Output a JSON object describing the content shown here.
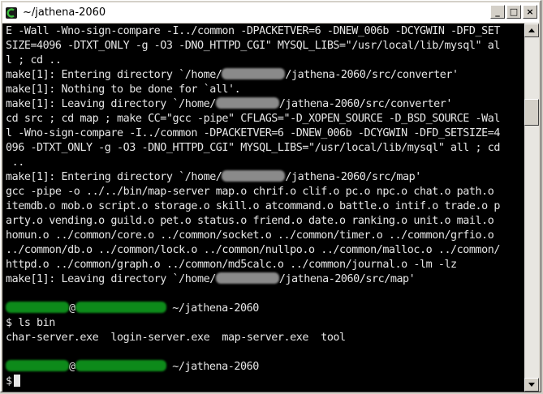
{
  "window": {
    "title": "~/jathena-2060",
    "icon": "cygwin-terminal-icon",
    "controls": {
      "minimize": "_",
      "maximize": "□",
      "close": "×"
    }
  },
  "terminal": {
    "lines": [
      {
        "parts": [
          {
            "t": "E -Wall -Wno-sign-compare -I../common -DPACKETVER=6 -DNEW_006b -DCYGWIN -DFD_SET"
          }
        ]
      },
      {
        "parts": [
          {
            "t": "SIZE=4096 -DTXT_ONLY -g -O3 -DNO_HTTPD_CGI\" MYSQL_LIBS=\"/usr/local/lib/mysql\" al"
          }
        ]
      },
      {
        "parts": [
          {
            "t": "l ; cd .."
          }
        ]
      },
      {
        "parts": [
          {
            "t": "make[1]: Entering directory `/home/"
          },
          {
            "blur": "gray",
            "w": 78
          },
          {
            "t": "/jathena-2060/src/converter'"
          }
        ]
      },
      {
        "parts": [
          {
            "t": "make[1]: Nothing to be done for `all'."
          }
        ]
      },
      {
        "parts": [
          {
            "t": "make[1]: Leaving directory `/home/"
          },
          {
            "blur": "gray",
            "w": 78
          },
          {
            "t": "/jathena-2060/src/converter'"
          }
        ]
      },
      {
        "parts": [
          {
            "t": "cd src ; cd map ; make CC=\"gcc -pipe\" CFLAGS=\"-D_XOPEN_SOURCE -D_BSD_SOURCE -Wal"
          }
        ]
      },
      {
        "parts": [
          {
            "t": "l -Wno-sign-compare -I../common -DPACKETVER=6 -DNEW_006b -DCYGWIN -DFD_SETSIZE=4"
          }
        ]
      },
      {
        "parts": [
          {
            "t": "096 -DTXT_ONLY -g -O3 -DNO_HTTPD_CGI\" MYSQL_LIBS=\"/usr/local/lib/mysql\" all ; cd"
          }
        ]
      },
      {
        "parts": [
          {
            "t": " .."
          }
        ]
      },
      {
        "parts": [
          {
            "t": "make[1]: Entering directory `/home/"
          },
          {
            "blur": "gray",
            "w": 78
          },
          {
            "t": "/jathena-2060/src/map'"
          }
        ]
      },
      {
        "parts": [
          {
            "t": "gcc -pipe -o ../../bin/map-server map.o chrif.o clif.o pc.o npc.o chat.o path.o"
          }
        ]
      },
      {
        "parts": [
          {
            "t": "itemdb.o mob.o script.o storage.o skill.o atcommand.o battle.o intif.o trade.o p"
          }
        ]
      },
      {
        "parts": [
          {
            "t": "arty.o vending.o guild.o pet.o status.o friend.o date.o ranking.o unit.o mail.o"
          }
        ]
      },
      {
        "parts": [
          {
            "t": "homun.o ../common/core.o ../common/socket.o ../common/timer.o ../common/grfio.o"
          }
        ]
      },
      {
        "parts": [
          {
            "t": "../common/db.o ../common/lock.o ../common/nullpo.o ../common/malloc.o ../common/"
          }
        ]
      },
      {
        "parts": [
          {
            "t": "httpd.o ../common/graph.o ../common/md5calc.o ../common/journal.o -lm -lz"
          }
        ]
      },
      {
        "parts": [
          {
            "t": "make[1]: Leaving directory `/home/"
          },
          {
            "blur": "gray",
            "w": 78
          },
          {
            "t": "/jathena-2060/src/map'"
          }
        ]
      },
      {
        "parts": [
          {
            "t": ""
          }
        ]
      },
      {
        "parts": [
          {
            "blur": "green",
            "w": 78
          },
          {
            "t": "@"
          },
          {
            "blur": "green",
            "w": 112
          },
          {
            "t": " ~/jathena-2060"
          }
        ]
      },
      {
        "parts": [
          {
            "t": "$ ls bin"
          }
        ]
      },
      {
        "parts": [
          {
            "t": "char-server.exe  login-server.exe  map-server.exe  tool"
          }
        ]
      },
      {
        "parts": [
          {
            "t": ""
          }
        ]
      },
      {
        "parts": [
          {
            "blur": "green",
            "w": 78
          },
          {
            "t": "@"
          },
          {
            "blur": "green",
            "w": 112
          },
          {
            "t": " ~/jathena-2060"
          }
        ]
      },
      {
        "parts": [
          {
            "t": "$"
          },
          {
            "cursor": true
          }
        ]
      }
    ]
  },
  "scrollbar": {
    "thumb_top_fraction": 0.18,
    "thumb_size_fraction": 0.08
  }
}
